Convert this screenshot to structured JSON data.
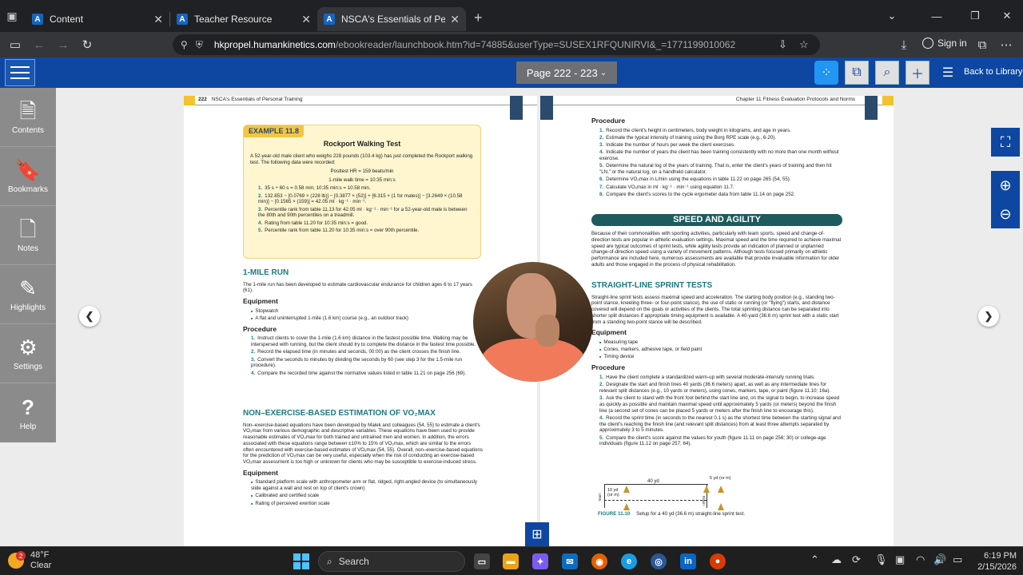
{
  "browser": {
    "tabs": [
      {
        "favicon": "A",
        "title": "Content"
      },
      {
        "favicon": "A",
        "title": "Teacher Resource"
      },
      {
        "favicon": "A",
        "title": "NSCA's Essentials of Personal Tr"
      }
    ],
    "url_host": "hkpropel.humankinetics.com",
    "url_path": "/ebookreader/launchbook.htm?id=74885&userType=SUSEX1RFQUNIRVI&_=1771199010062",
    "signin_label": "Sign in"
  },
  "reader": {
    "page_selector": "Page 222 - 223",
    "back_label": "Back to Library",
    "sidebar": [
      {
        "label": "Contents",
        "icon": "document-icon"
      },
      {
        "label": "Bookmarks",
        "icon": "bookmark-icon"
      },
      {
        "label": "Notes",
        "icon": "note-icon"
      },
      {
        "label": "Highlights",
        "icon": "pencil-icon"
      },
      {
        "label": "Settings",
        "icon": "gear-icon"
      },
      {
        "label": "Help",
        "icon": "question-icon"
      }
    ]
  },
  "left_page": {
    "header_num": "222",
    "header_title": "NSCA's Essentials of Personal Training",
    "example_tag": "EXAMPLE 11.8",
    "example_title": "Rockport Walking Test",
    "example_intro": "A 52-year-old male client who weighs 228 pounds (103.4 kg) has just completed the Rockport walking test. The following data were recorded:",
    "example_hr": "Posttest HR = 159 beats/min",
    "example_time": "1-mile walk time = 10:35 min:s",
    "example_steps": [
      "35 s ÷ 60 s = 0.58 min; 10:35 min:s = 10.58 min.",
      "132.853 − [0.0769 × (228 lb)] − [0.3877 × (52)] + [6.315 × (1 for males)] − [3.2649 × (10.58 min)] − [0.1565 × (159)] = 42.05 ml · kg⁻¹ · min⁻¹.",
      "Percentile rank from table 11.13 for 42.05 ml · kg⁻¹ · min⁻¹ for a 52-year-old male is between the 80th and 90th percentiles on a treadmill.",
      "Rating from table 11.20 for 10:35 min:s = good.",
      "Percentile rank from table 11.20 for 10:35 min:s = over 90th percentile."
    ],
    "run_heading": "1-MILE RUN",
    "run_intro": "The 1-mile run has been developed to estimate cardiovascular endurance for children ages 6 to 17 years (61).",
    "equipment_label": "Equipment",
    "procedure_label": "Procedure",
    "run_equipment": [
      "Stopwatch",
      "A flat and uninterrupted 1-mile (1.6 km) course (e.g., an outdoor track)"
    ],
    "run_procedure": [
      "Instruct clients to cover the 1-mile (1.6 km) distance in the fastest possible time. Walking may be interspersed with running, but the client should try to complete the distance in the fastest time possible.",
      "Record the elapsed time (in minutes and seconds, 00:00) as the client crosses the finish line.",
      "Convert the seconds to minutes by dividing the seconds by 60 (see step 3 for the 1.5-mile run procedure).",
      "Compare the recorded time against the normative values listed in table 11.21 on page 256 (69)."
    ],
    "nonex_heading": "NON–EXERCISE-BASED ESTIMATION OF VO₂MAX",
    "nonex_text": "Non–exercise-based equations have been developed by Malek and colleagues (54, 55) to estimate a client's VO₂max from various demographic and descriptive variables. These equations have been used to provide reasonable estimates of VO₂max for both trained and untrained men and women. In addition, the errors associated with these equations range between ±10% to 15% of VO₂max, which are similar to the errors often encountered with exercise-based estimates of VO₂max (54, 55). Overall, non–exercise-based equations for the prediction of VO₂max can be very useful, especially when the risk of conducting an exercise-based VO₂max assessment is too high or unknown for clients who may be susceptible to exercise-induced stress.",
    "nonex_equipment": [
      "Standard platform scale with anthropometer arm or flat, ridged, right-angled device (to simultaneously slide against a wall and rest on top of client's crown)",
      "Calibrated and certified scale",
      "Rating of perceived exertion scale"
    ]
  },
  "right_page": {
    "header_title": "Chapter 11   Fitness Evaluation Protocols and Norms",
    "procedure_label": "Procedure",
    "equipment_label": "Equipment",
    "procedure": [
      "Record the client's height in centimeters, body weight in kilograms, and age in years.",
      "Estimate the typical intensity of training using the Borg RPE scale (e.g., 6-20).",
      "Indicate the number of hours per week the client exercises.",
      "Indicate the number of years the client has been training consistently with no more than one month without exercise.",
      "Determine the natural log of the years of training. That is, enter the client's years of training and then hit \"LN,\" or the natural log, on a handheld calculator.",
      "Determine VO₂max in L/min using the equations in table 11.22 on page 265 (54, 55).",
      "Calculate VO₂max in ml · kg⁻¹ · min⁻¹ using equation 11.7.",
      "Compare the client's scores to the cycle ergometer data from table 11.14 on page 252."
    ],
    "speed_heading": "SPEED AND AGILITY",
    "speed_text": "Because of their commonalities with sporting activities, particularly with team sports, speed and change-of-direction tests are popular in athletic evaluation settings. Maximal speed and the time required to achieve maximal speed are typical outcomes of sprint tests, while agility tests provide an indication of planned or unplanned change-of-direction speed using a variety of movement patterns. Although tests focused primarily on athletic performance are included here, numerous assessments are available that provide invaluable information for older adults and those engaged in the process of physical rehabilitation.",
    "sprint_heading": "STRAIGHT-LINE SPRINT TESTS",
    "sprint_text": "Straight-line sprint tests assess maximal speed and acceleration. The starting body position (e.g., standing two-point stance, kneeling three- or four-point stance), the use of static or running (or \"flying\") starts, and distance covered will depend on the goals or activities of the clients. The total sprinting distance can be separated into shorter split distances if appropriate timing equipment is available. A 40-yard (36.6 m) sprint test with a static start from a standing two-point stance will be described.",
    "sprint_equipment": [
      "Measuring tape",
      "Cones, markers, adhesive tape, or field paint",
      "Timing device"
    ],
    "sprint_procedure": [
      "Have the client complete a standardized warm-up with several moderate-intensity running trials.",
      "Designate the start and finish lines 40 yards (36.6 meters) apart, as well as any intermediate lines for relevant split distances (e.g., 10 yards or meters), using cones, markers, tape, or paint (figure 11.10; 16a).",
      "Ask the client to stand with the front foot behind the start line and, on the signal to begin, to increase speed as quickly as possible and maintain maximal speed until approximately 5 yards (or meters) beyond the finish line (a second set of cones can be placed 5 yards or meters after the finish line to encourage this).",
      "Record the sprint time (in seconds to the nearest 0.1 s) as the shortest time between the starting signal and the client's reaching the finish line (and relevant split distances) from at least three attempts separated by approximately 3 to 5 minutes.",
      "Compare the client's score against the values for youth (figure 11.11 on page 256; 30) or college-age individuals (figure 11.12 on page 257; 64)."
    ],
    "fig_labels": {
      "d40": "40 yd",
      "d5": "5 yd (or m)",
      "d10": "10 yd",
      "d10b": "(or m)",
      "start": "Start",
      "finish": "Finish"
    },
    "fig_num": "FIGURE 11.10",
    "fig_caption": "Setup for a 40 yd (36.6 m) straight-line sprint test."
  },
  "taskbar": {
    "temp": "48°F",
    "condition": "Clear",
    "weather_badge": "2",
    "search_label": "Search",
    "time": "6:19 PM",
    "date": "2/15/2026"
  }
}
